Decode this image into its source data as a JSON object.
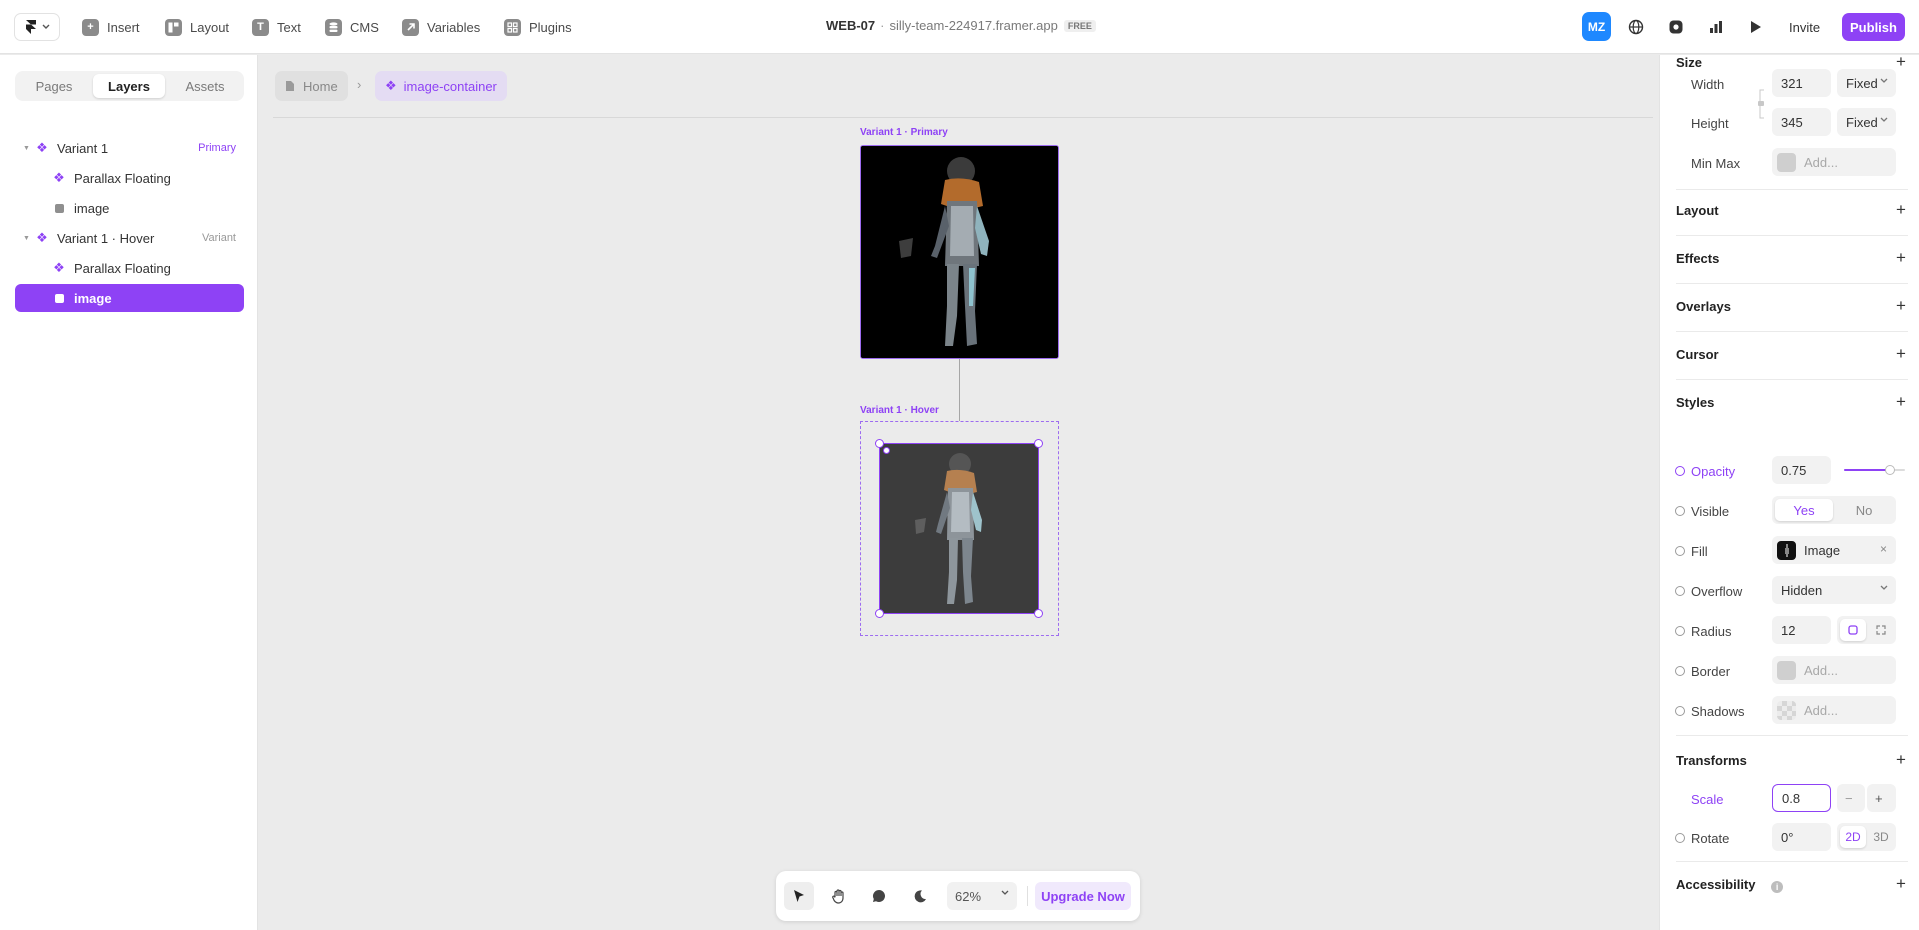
{
  "topbar": {
    "tools": [
      {
        "label": "Insert",
        "icon": "plus-icon"
      },
      {
        "label": "Layout",
        "icon": "layout-icon"
      },
      {
        "label": "Text",
        "icon": "text-icon"
      },
      {
        "label": "CMS",
        "icon": "database-icon"
      },
      {
        "label": "Variables",
        "icon": "variables-icon"
      },
      {
        "label": "Plugins",
        "icon": "plugins-icon"
      }
    ],
    "project": "WEB-07",
    "separator": "·",
    "domain": "silly-team-224917.framer.app",
    "plan_badge": "FREE",
    "avatar": "MZ",
    "invite": "Invite",
    "publish": "Publish"
  },
  "left_panel": {
    "tabs": [
      "Pages",
      "Layers",
      "Assets"
    ],
    "active_tab": "Layers",
    "layers": [
      {
        "label": "Variant 1",
        "tag": "Primary",
        "type": "component"
      },
      {
        "label": "Parallax Floating",
        "tag": "",
        "type": "component"
      },
      {
        "label": "image",
        "tag": "",
        "type": "image"
      },
      {
        "label": "Variant 1 · Hover",
        "tag": "Variant",
        "type": "component"
      },
      {
        "label": "Parallax Floating",
        "tag": "",
        "type": "component"
      },
      {
        "label": "image",
        "tag": "",
        "type": "image",
        "selected": true
      }
    ]
  },
  "canvas": {
    "breadcrumb_home": "Home",
    "breadcrumb_current": "image-container",
    "variant_primary_label": "Variant 1 · Primary",
    "variant_hover_label": "Variant 1 · Hover",
    "zoom": "62%",
    "upgrade": "Upgrade Now"
  },
  "right_panel": {
    "size": {
      "title": "Size",
      "width_label": "Width",
      "width_value": "321",
      "width_mode": "Fixed",
      "height_label": "Height",
      "height_value": "345",
      "height_mode": "Fixed",
      "minmax_label": "Min Max",
      "minmax_placeholder": "Add..."
    },
    "sections": [
      "Layout",
      "Effects",
      "Overlays",
      "Cursor"
    ],
    "styles": {
      "title": "Styles",
      "opacity_label": "Opacity",
      "opacity_value": "0.75",
      "opacity_level": 0.75,
      "visible_label": "Visible",
      "visible_yes": "Yes",
      "visible_no": "No",
      "fill_label": "Fill",
      "fill_value": "Image",
      "overflow_label": "Overflow",
      "overflow_value": "Hidden",
      "radius_label": "Radius",
      "radius_value": "12",
      "border_label": "Border",
      "border_placeholder": "Add...",
      "shadows_label": "Shadows",
      "shadows_placeholder": "Add..."
    },
    "transforms": {
      "title": "Transforms",
      "scale_label": "Scale",
      "scale_value": "0.8",
      "rotate_label": "Rotate",
      "rotate_value": "0°",
      "mode_2d": "2D",
      "mode_3d": "3D"
    },
    "accessibility": "Accessibility"
  },
  "colors": {
    "accent": "#8e42f5",
    "avatar": "#1e88ff",
    "canvas": "#ebebeb"
  }
}
